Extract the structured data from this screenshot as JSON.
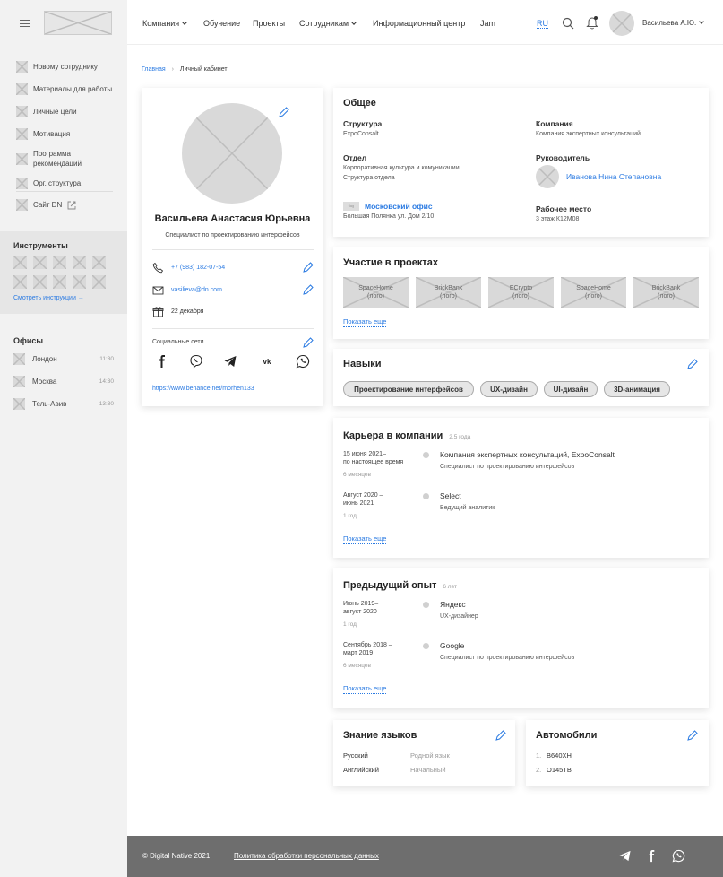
{
  "sidebar": {
    "menu": [
      {
        "label": "Новому сотруднику"
      },
      {
        "label": "Материалы для работы"
      },
      {
        "label": "Личные цели"
      },
      {
        "label": "Мотивация"
      },
      {
        "label": "Программа рекомендаций"
      },
      {
        "label": "Орг. структура"
      }
    ],
    "site_link": "Сайт DN",
    "tools_title": "Инструменты",
    "tools_link": "Смотреть инструкции →",
    "offices_title": "Офисы",
    "offices": [
      {
        "name": "Лондон",
        "time": "11:30"
      },
      {
        "name": "Москва",
        "time": "14:30"
      },
      {
        "name": "Тель-Авив",
        "time": "13:30"
      }
    ]
  },
  "header": {
    "nav": [
      "Компания",
      "Обучение",
      "Проекты",
      "Сотрудникам",
      "Информационный центр",
      "Jam"
    ],
    "lang": "RU",
    "user_name": "Васильева А.Ю."
  },
  "breadcrumb": {
    "home": "Главная",
    "separator": "›",
    "current": "Личный кабинет"
  },
  "profile": {
    "name": "Васильева Анастасия Юрьевна",
    "role": "Специалист по проектированию интерфейсов",
    "phone": "+7 (983) 182-07-54",
    "email": "vasilieva@dn.com",
    "birthday": "22 декабря",
    "social_label": "Социальные сети",
    "behance": "https://www.behance.net/morhen133"
  },
  "general": {
    "title": "Общее",
    "structure_label": "Структура",
    "structure_value": "ExpoConsalt",
    "company_label": "Компания",
    "company_value": "Компания экспертных консультаций",
    "dept_label": "Отдел",
    "dept_value": "Корпоративная культура и комуникации",
    "dept_link": "Структура отдела",
    "manager_label": "Руководитель",
    "manager_name": "Иванова Нина Степановна",
    "office_flag": "flag",
    "office_name": "Московский офис",
    "office_address": "Большая Полянка ул. Дом 2/10",
    "workplace_label": "Рабочее место",
    "workplace_value": "3 этаж К12М08"
  },
  "projects": {
    "title": "Участие в проектах",
    "items": [
      {
        "name": "SpaceHome",
        "sub": "(лого)"
      },
      {
        "name": "BrickBank",
        "sub": "(лого)"
      },
      {
        "name": "ECrypto",
        "sub": "(лого)"
      },
      {
        "name": "SpaceHome",
        "sub": "(лого)"
      },
      {
        "name": "BrickBank",
        "sub": "(лого)"
      }
    ],
    "more": "Показать еще"
  },
  "skills": {
    "title": "Навыки",
    "items": [
      "Проектирование интерфейсов",
      "UX-дизайн",
      "UI-дизайн",
      "3D-анимация"
    ]
  },
  "career": {
    "title": "Карьера в компании",
    "total": "2,5 года",
    "entries": [
      {
        "date_1": "15 июня 2021–",
        "date_2": "по настоящее время",
        "duration": "6 месяцев",
        "company": "Компания экспертных консультаций, ExpoConsalt",
        "position": "Специалист по проектированию интерфейсов"
      },
      {
        "date_1": "Август 2020 –",
        "date_2": "июнь 2021",
        "duration": "1 год",
        "company": "Select",
        "position": "Ведущий аналитик"
      }
    ],
    "more": "Показать еще"
  },
  "experience": {
    "title": "Предыдущий опыт",
    "total": "6 лет",
    "entries": [
      {
        "date_1": "Июнь 2019–",
        "date_2": "август 2020",
        "duration": "1 год",
        "company": "Яндекс",
        "position": "UX-дизайнер"
      },
      {
        "date_1": "Сентябрь 2018 –",
        "date_2": "март 2019",
        "duration": "6 месяцев",
        "company": "Google",
        "position": "Специалист по проектированию интерфейсов"
      }
    ],
    "more": "Показать еще"
  },
  "languages": {
    "title": "Знание языков",
    "items": [
      {
        "lang": "Русский",
        "level": "Родной язык"
      },
      {
        "lang": "Английский",
        "level": "Начальный"
      }
    ]
  },
  "cars": {
    "title": "Автомобили",
    "items": [
      {
        "num": "1.",
        "plate": "В640ХН"
      },
      {
        "num": "2.",
        "plate": "О145ТВ"
      }
    ]
  },
  "footer": {
    "copyright": "© Digital Native 2021",
    "policy": "Политика обработки персональных данных"
  },
  "colors": {
    "accent": "#2a7ae2",
    "sidebar_bg": "#f2f2f2",
    "footer_bg": "#6e6e6e"
  }
}
